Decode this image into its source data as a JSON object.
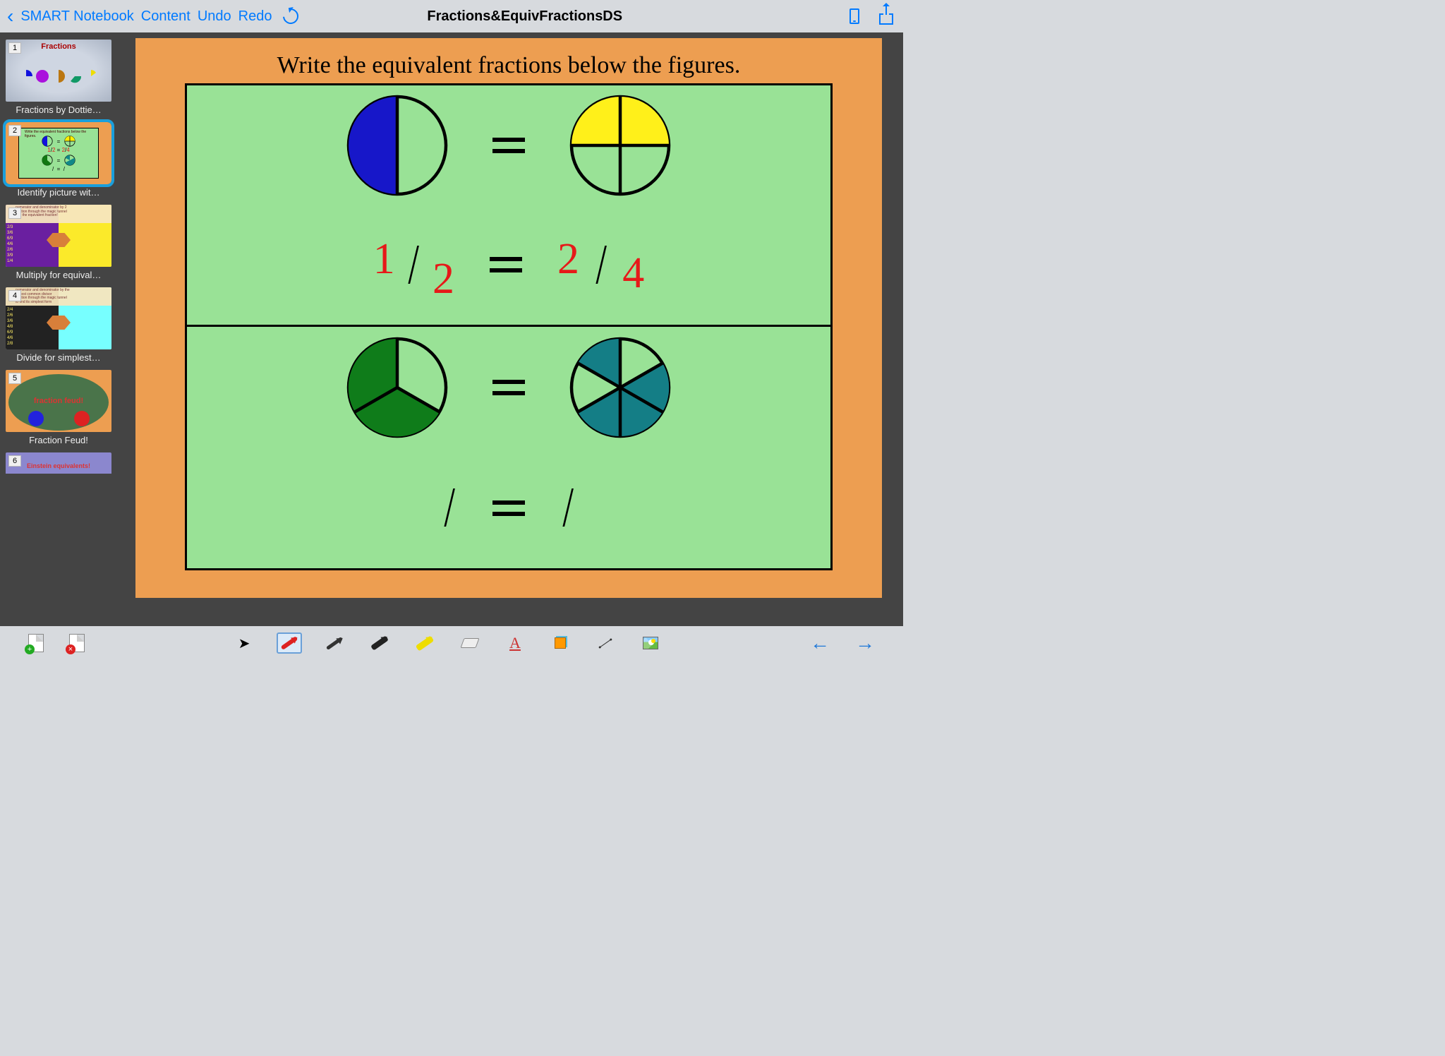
{
  "topbar": {
    "app_name": "SMART Notebook",
    "content_label": "Content",
    "undo_label": "Undo",
    "redo_label": "Redo",
    "document_title": "Fractions&EquivFractionsDS"
  },
  "sidebar": {
    "slides": [
      {
        "num": "1",
        "label": "Fractions by Dottie…",
        "title": "Fractions"
      },
      {
        "num": "2",
        "label": "Identify picture wit…",
        "selected": true
      },
      {
        "num": "3",
        "label": "Multiply for equival…"
      },
      {
        "num": "4",
        "label": "Divide for simplest…"
      },
      {
        "num": "5",
        "label": "Fraction Feud!",
        "inner_text": "fraction feud!"
      },
      {
        "num": "6",
        "label": "",
        "inner_text": "Einstein equivalents!"
      }
    ]
  },
  "canvas": {
    "instruction": "Write the equivalent fractions below the figures.",
    "row1": {
      "left_fraction": {
        "num": "1",
        "den": "2"
      },
      "right_fraction": {
        "num": "2",
        "den": "4"
      }
    }
  },
  "bottombar": {
    "tools": [
      {
        "name": "cursor",
        "selected": false
      },
      {
        "name": "pen-red",
        "selected": true
      },
      {
        "name": "pen-thin",
        "selected": false
      },
      {
        "name": "pen-thick",
        "selected": false
      },
      {
        "name": "highlighter",
        "selected": false
      },
      {
        "name": "eraser",
        "selected": false
      },
      {
        "name": "text",
        "selected": false
      },
      {
        "name": "shape",
        "selected": false
      },
      {
        "name": "line",
        "selected": false
      },
      {
        "name": "image",
        "selected": false
      }
    ]
  },
  "thumb3_nums": [
    "2/3",
    "3/6",
    "6/9",
    "4/6",
    "2/6",
    "3/9",
    "1/4"
  ],
  "thumb4_nums": [
    "2/4",
    "2/6",
    "3/6",
    "4/8",
    "6/9",
    "4/6",
    "2/8"
  ]
}
